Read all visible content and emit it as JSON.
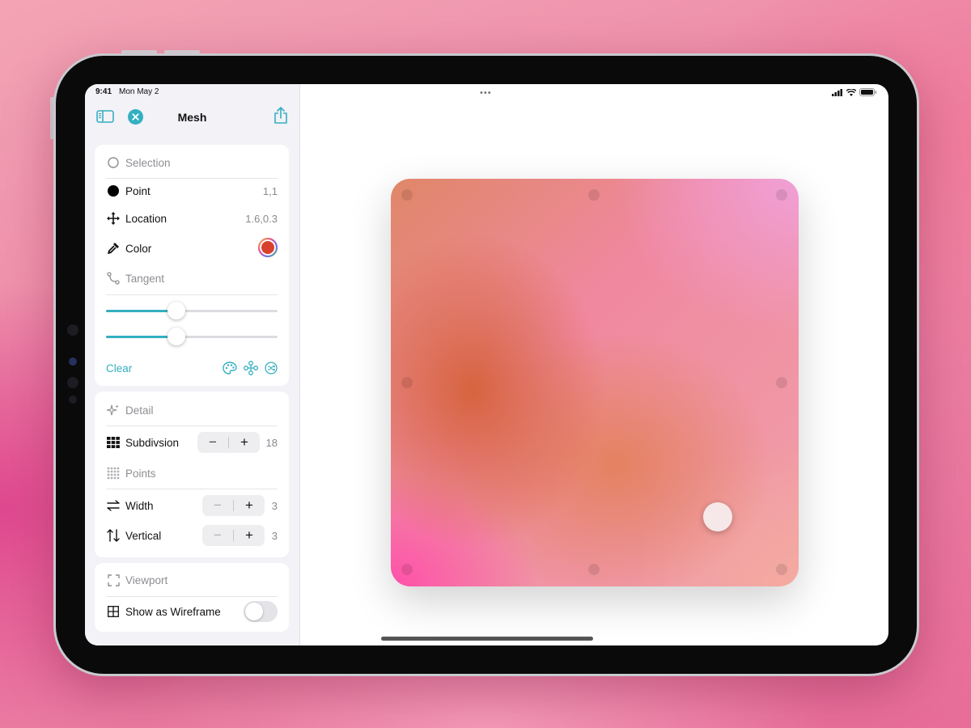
{
  "status_bar": {
    "time": "9:41",
    "date": "Mon May 2",
    "dots": "•••"
  },
  "sidebar": {
    "title": "Mesh",
    "selection_card": {
      "selection_label": "Selection",
      "point_label": "Point",
      "point_value": "1,1",
      "location_label": "Location",
      "location_value": "1.6,0.3",
      "color_label": "Color",
      "color_swatch": "#d9412f",
      "tangent_label": "Tangent",
      "slider_1_value": 0.41,
      "slider_2_value": 0.41,
      "clear_label": "Clear"
    },
    "detail_card": {
      "detail_label": "Detail",
      "subdivision_label": "Subdivsion",
      "subdivision_value": "18",
      "points_label": "Points",
      "width_label": "Width",
      "width_value": "3",
      "vertical_label": "Vertical",
      "vertical_value": "3"
    },
    "viewport_card": {
      "viewport_label": "Viewport",
      "wireframe_label": "Show as Wireframe",
      "wireframe_on": false
    }
  },
  "colors": {
    "accent": "#34afc1",
    "sidebar_bg": "#f2f2f7"
  },
  "icons": [
    "sidebar-toggle-icon",
    "close-icon",
    "share-icon",
    "circle-icon",
    "point-icon",
    "move-icon",
    "color-picker-icon",
    "tangent-icon",
    "palette-icon",
    "nodes-icon",
    "shuffle-icon",
    "sparkle-icon",
    "grid-icon",
    "dots-grid-icon",
    "width-arrows-icon",
    "vertical-arrows-icon",
    "viewport-icon",
    "wireframe-icon"
  ]
}
